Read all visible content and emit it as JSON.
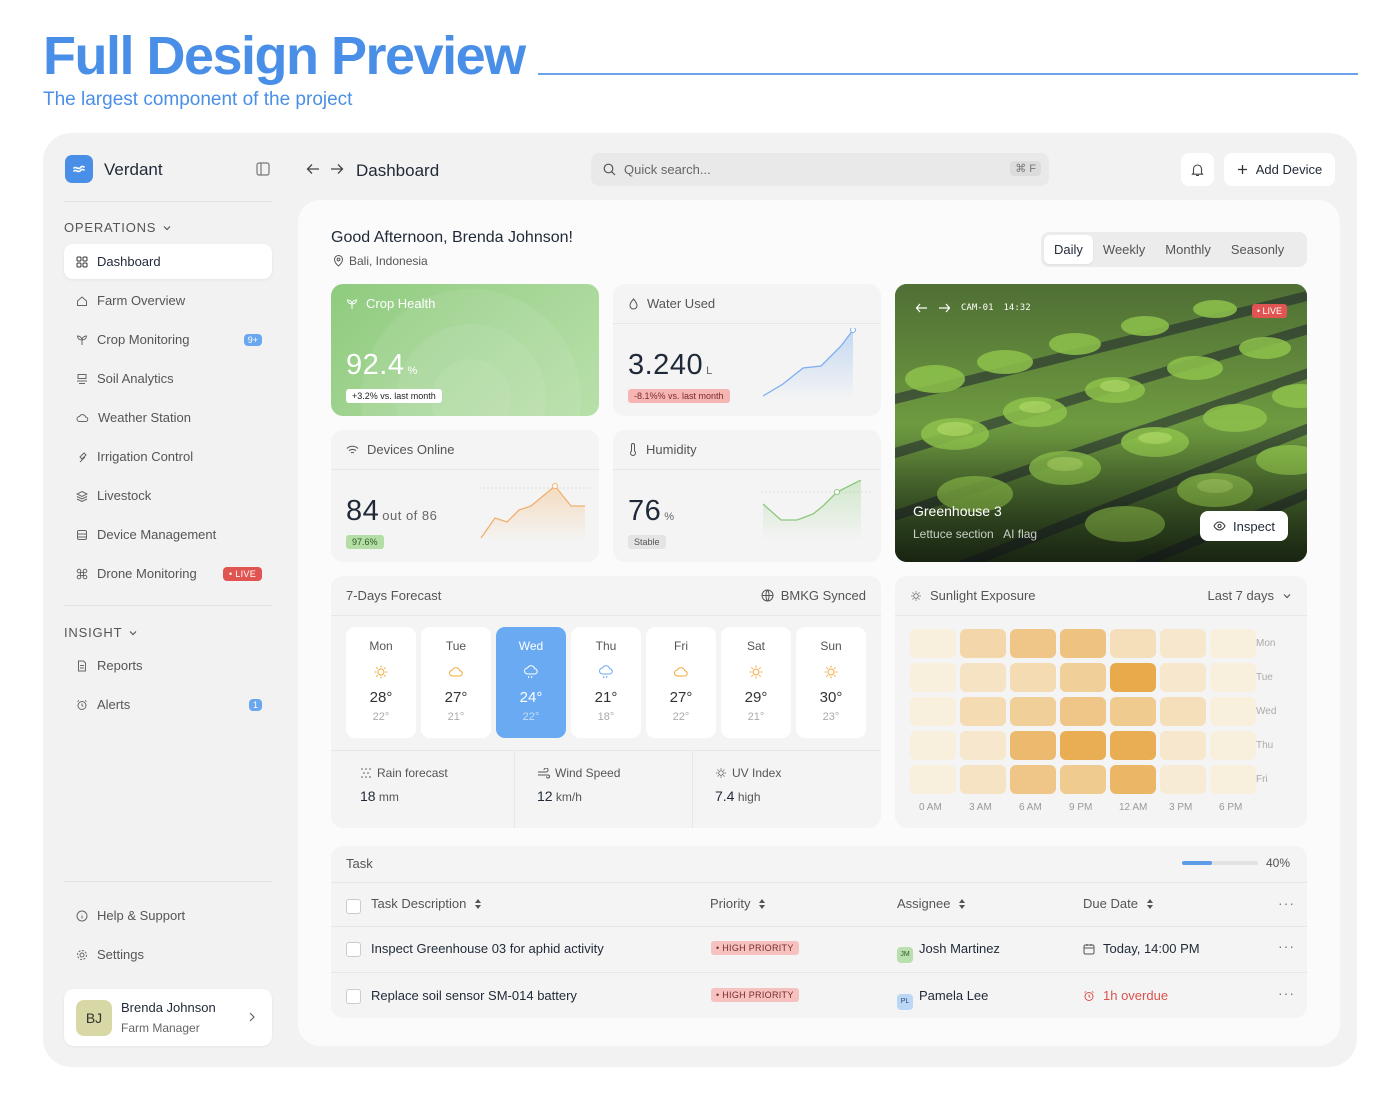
{
  "hero": {
    "title": "Full Design Preview",
    "subtitle": "The largest component of the project"
  },
  "sidebar": {
    "brand": "Verdant",
    "operations_label": "OPERATIONS",
    "items": [
      {
        "label": "Dashboard",
        "icon": "grid-icon"
      },
      {
        "label": "Farm Overview",
        "icon": "home-icon"
      },
      {
        "label": "Crop Monitoring",
        "icon": "sprout-icon",
        "badge": "9+"
      },
      {
        "label": "Soil Analytics",
        "icon": "layers-icon"
      },
      {
        "label": "Weather Station",
        "icon": "cloud-icon"
      },
      {
        "label": "Irrigation Control",
        "icon": "droplet-icon"
      },
      {
        "label": "Livestock",
        "icon": "stack-icon"
      },
      {
        "label": "Device Management",
        "icon": "device-icon"
      },
      {
        "label": "Drone Monitoring",
        "icon": "drone-icon",
        "badge": "• LIVE"
      }
    ],
    "insight_label": "INSIGHT",
    "insight_items": [
      {
        "label": "Reports",
        "icon": "document-icon"
      },
      {
        "label": "Alerts",
        "icon": "alarm-icon",
        "badge": "1"
      }
    ],
    "help": "Help & Support",
    "settings": "Settings",
    "user": {
      "initials": "BJ",
      "name": "Brenda Johnson",
      "role": "Farm Manager"
    }
  },
  "topbar": {
    "breadcrumb": "Dashboard",
    "search_placeholder": "Quick search...",
    "search_shortcut": "⌘ F",
    "add_device": "Add Device"
  },
  "main": {
    "greeting": "Good Afternoon, Brenda Johnson!",
    "location": "Bali, Indonesia",
    "periods": [
      "Daily",
      "Weekly",
      "Monthly",
      "Seasonly"
    ],
    "selected_period": "Daily"
  },
  "cards": {
    "crop_health": {
      "title": "Crop Health",
      "value": "92.4",
      "unit": "%",
      "delta": "+3.2% vs. last month"
    },
    "water_used": {
      "title": "Water Used",
      "value": "3.240",
      "unit": "L",
      "delta": "-8.1%% vs. last month"
    },
    "devices_online": {
      "title": "Devices Online",
      "value": "84",
      "unit": "out of 86",
      "delta": "97.6%"
    },
    "humidity": {
      "title": "Humidity",
      "value": "76",
      "unit": "%",
      "delta": "Stable"
    }
  },
  "camera": {
    "cam_id": "CAM-01",
    "time": "14:32",
    "live": "• LIVE",
    "title": "Greenhouse 3",
    "subtitle": "Lettuce section",
    "flag": "AI flag",
    "inspect": "Inspect"
  },
  "forecast": {
    "title": "7-Days Forecast",
    "sync": "BMKG Synced",
    "days": [
      {
        "day": "Mon",
        "hi": "28°",
        "lo": "22°",
        "icon": "sun-icon"
      },
      {
        "day": "Tue",
        "hi": "27°",
        "lo": "21°",
        "icon": "cloud-icon"
      },
      {
        "day": "Wed",
        "hi": "24°",
        "lo": "22°",
        "icon": "rain-cloud-icon"
      },
      {
        "day": "Thu",
        "hi": "21°",
        "lo": "18°",
        "icon": "rain-cloud-icon"
      },
      {
        "day": "Fri",
        "hi": "27°",
        "lo": "22°",
        "icon": "cloud-icon"
      },
      {
        "day": "Sat",
        "hi": "29°",
        "lo": "21°",
        "icon": "sun-icon"
      },
      {
        "day": "Sun",
        "hi": "30°",
        "lo": "23°",
        "icon": "sun-icon"
      }
    ],
    "selected_day": "Wed",
    "rain": {
      "label": "Rain forecast",
      "value": "18",
      "unit": "mm"
    },
    "wind": {
      "label": "Wind Speed",
      "value": "12",
      "unit": "km/h"
    },
    "uv": {
      "label": "UV Index",
      "value": "7.4",
      "unit": "high"
    }
  },
  "sunlight": {
    "title": "Sunlight Exposure",
    "range": "Last 7 days",
    "rows": [
      "Mon",
      "Tue",
      "Wed",
      "Thu",
      "Fri"
    ],
    "cols": [
      "0 AM",
      "3 AM",
      "6 AM",
      "9 PM",
      "12 AM",
      "3 PM",
      "6 PM"
    ],
    "levels": [
      [
        0.05,
        0.35,
        0.55,
        0.6,
        0.25,
        0.15,
        0.05
      ],
      [
        0.05,
        0.2,
        0.3,
        0.45,
        0.9,
        0.15,
        0.05
      ],
      [
        0.05,
        0.3,
        0.45,
        0.55,
        0.5,
        0.25,
        0.05
      ],
      [
        0.05,
        0.15,
        0.7,
        0.85,
        0.85,
        0.15,
        0.05
      ],
      [
        0.05,
        0.2,
        0.55,
        0.5,
        0.75,
        0.1,
        0.05
      ]
    ],
    "colors": {
      "low": "#faf3e6",
      "high": "#e6a23a"
    }
  },
  "tasks": {
    "title": "Task",
    "progress": 0.4,
    "progress_label": "40%",
    "headers": [
      "Task Description",
      "Priority",
      "Assignee",
      "Due Date"
    ],
    "rows": [
      {
        "desc": "Inspect Greenhouse 03 for aphid activity",
        "priority": "• HIGH PRIORITY",
        "initials": "JM",
        "assignee": "Josh Martinez",
        "due": "Today, 14:00 PM"
      },
      {
        "desc": "Replace soil sensor SM-014 battery",
        "priority": "• HIGH PRIORITY",
        "initials": "PL",
        "assignee": "Pamela Lee",
        "due": "1h overdue"
      }
    ]
  }
}
